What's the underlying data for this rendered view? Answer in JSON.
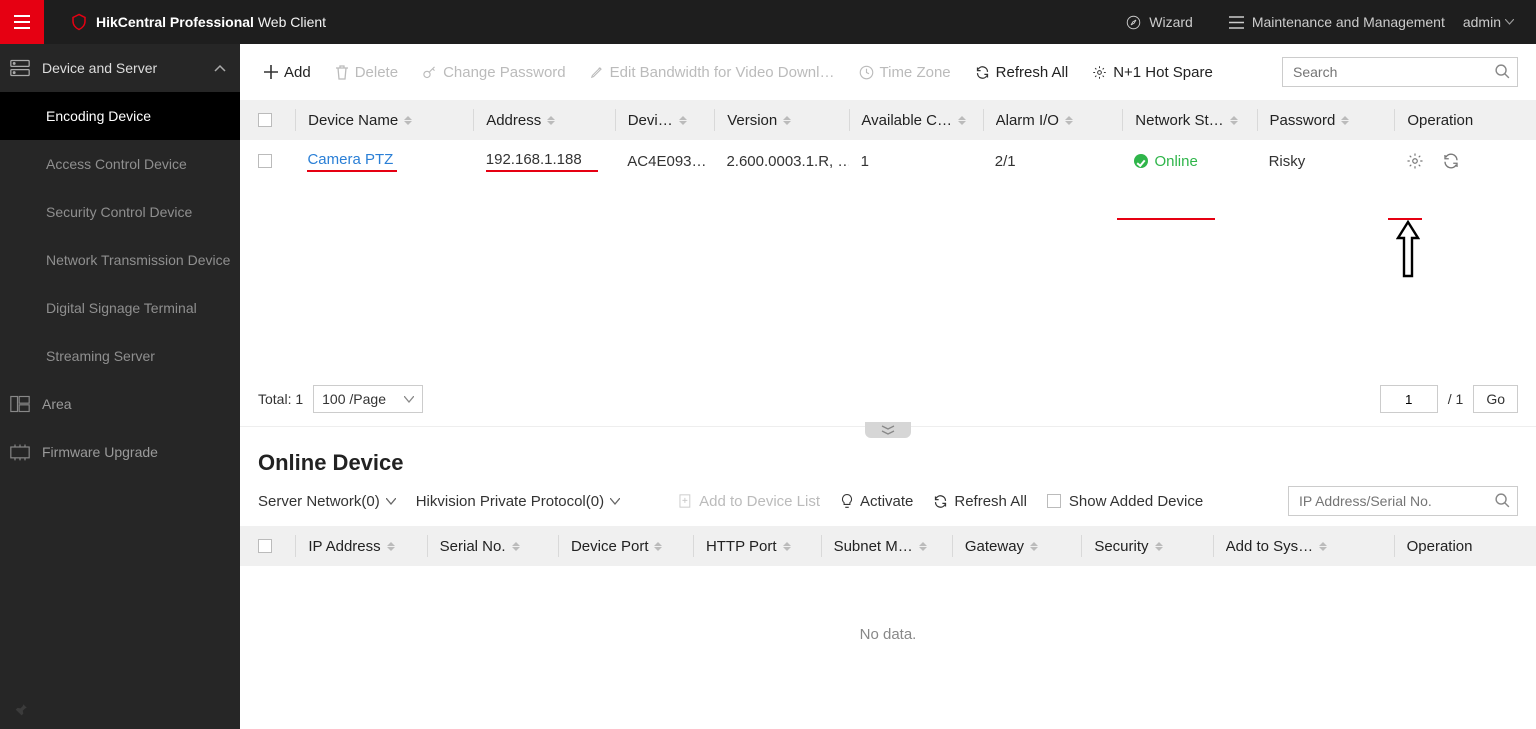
{
  "topbar": {
    "brand_bold": "HikCentral Professional",
    "brand_thin": " Web Client",
    "wizard": "Wizard",
    "maint": "Maintenance and Management",
    "user": "admin"
  },
  "sidebar": {
    "group1": "Device and Server",
    "items": [
      "Encoding Device",
      "Access Control Device",
      "Security Control Device",
      "Network Transmission Device",
      "Digital Signage Terminal",
      "Streaming Server"
    ],
    "group2": "Area",
    "group3": "Firmware Upgrade"
  },
  "toolbar": {
    "add": "Add",
    "delete": "Delete",
    "change_pw": "Change Password",
    "bandwidth": "Edit Bandwidth for Video Downl…",
    "timezone": "Time Zone",
    "refresh": "Refresh All",
    "hotspare": "N+1 Hot Spare",
    "search_placeholder": "Search"
  },
  "columns": {
    "device_name": "Device Name",
    "address": "Address",
    "device": "Devi…",
    "version": "Version",
    "available": "Available C…",
    "alarm": "Alarm I/O",
    "network": "Network St…",
    "password": "Password",
    "operation": "Operation"
  },
  "row": {
    "device_name": "Camera PTZ",
    "address": "192.168.1.188",
    "device": "AC4E093…",
    "version": "2.600.0003.1.R, …",
    "available": "1",
    "alarm": "2/1",
    "network": "Online",
    "password": "Risky"
  },
  "pager": {
    "total_label": "Total: 1",
    "per_page": "100 /Page",
    "page": "1",
    "of": "/ 1",
    "go": "Go"
  },
  "online": {
    "title": "Online Device",
    "server_net": "Server Network(0)",
    "protocol": "Hikvision Private Protocol(0)",
    "add_list": "Add to Device List",
    "activate": "Activate",
    "refresh": "Refresh All",
    "show_added": "Show Added Device",
    "search_placeholder": "IP Address/Serial No.",
    "nodata": "No data.",
    "cols": {
      "ip": "IP Address",
      "serial": "Serial No.",
      "port": "Device Port",
      "http": "HTTP Port",
      "subnet": "Subnet M…",
      "gateway": "Gateway",
      "security": "Security",
      "addsys": "Add to Sys…",
      "operation": "Operation"
    }
  }
}
